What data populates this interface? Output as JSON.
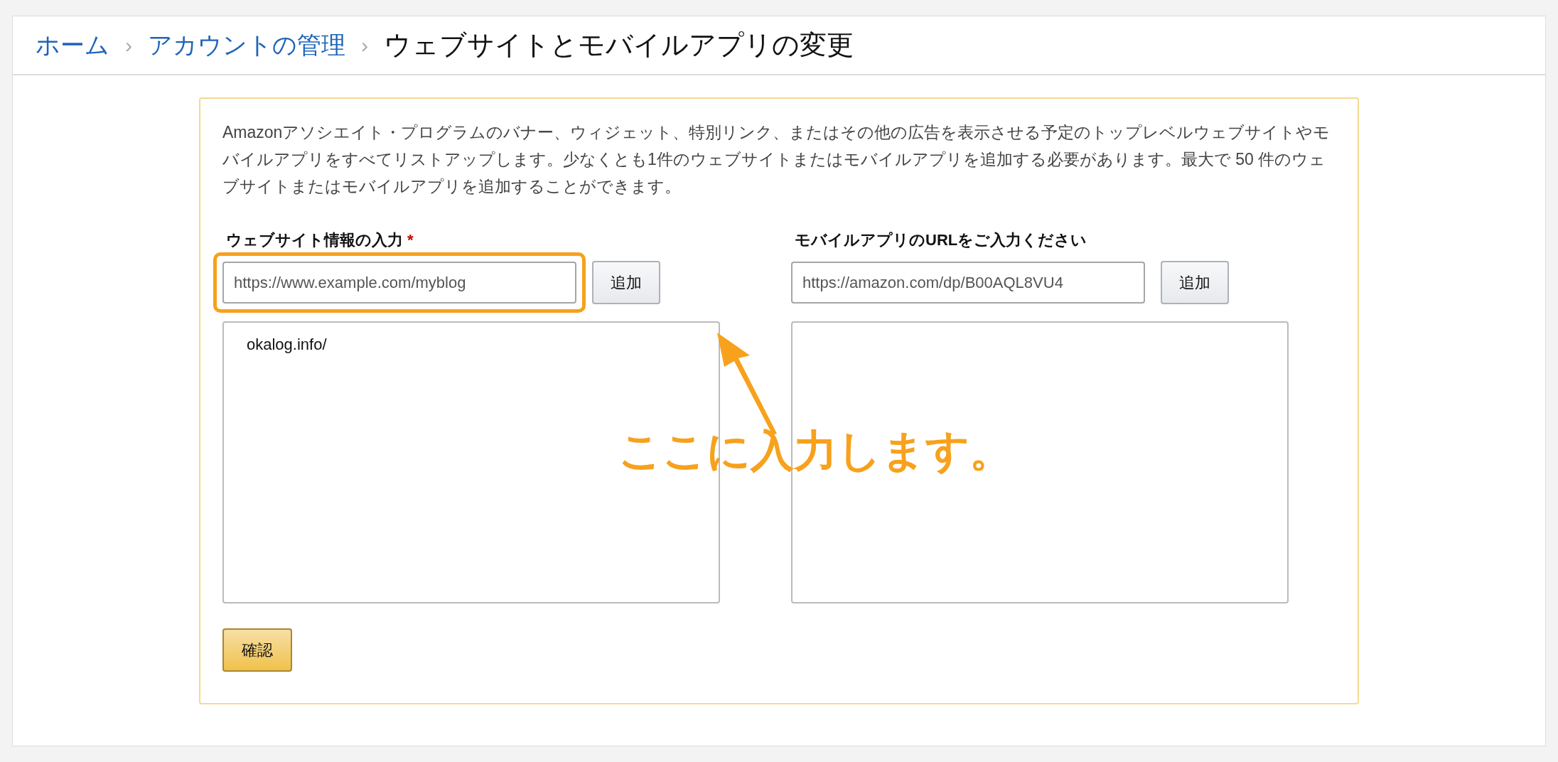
{
  "breadcrumb": {
    "links": [
      "ホーム",
      "アカウントの管理"
    ],
    "separator": "›",
    "current": "ウェブサイトとモバイルアプリの変更"
  },
  "description": "Amazonアソシエイト・プログラムのバナー、ウィジェット、特別リンク、またはその他の広告を表示させる予定のトップレベルウェブサイトやモバイルアプリをすべてリストアップします。少なくとも1件のウェブサイトまたはモバイルアプリを追加する必要があります。最大で 50 件のウェブサイトまたはモバイルアプリを追加することができます。",
  "columns": [
    {
      "label": "ウェブサイト情報の入力",
      "required": true,
      "required_mark": "*",
      "placeholder": "https://www.example.com/myblog",
      "button": "追加",
      "highlighted": true,
      "items": [
        "okalog.info/"
      ]
    },
    {
      "label": "モバイルアプリのURLをご入力ください",
      "required": false,
      "placeholder": "https://amazon.com/dp/B00AQL8VU4",
      "button": "追加",
      "highlighted": false
    }
  ],
  "confirm_button": "確認",
  "annotation": {
    "text": "ここに入力します。"
  }
}
